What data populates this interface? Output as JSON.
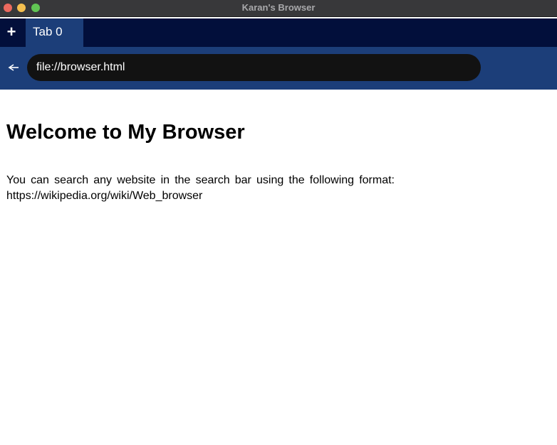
{
  "window": {
    "title": "Karan's Browser"
  },
  "tabstrip": {
    "new_tab_label": "+",
    "tabs": [
      {
        "label": "Tab 0"
      }
    ]
  },
  "toolbar": {
    "back_icon": "back-arrow-icon",
    "url_value": "file://browser.html"
  },
  "page": {
    "heading": "Welcome to My Browser",
    "paragraph_line1": "You can search any website in the search bar using the following format:",
    "paragraph_line2": "https://wikipedia.org/wiki/Web_browser"
  },
  "colors": {
    "titlebar": "#38383a",
    "tabstrip": "#020f3b",
    "active_tab": "#1c3e79",
    "addressbar": "#1c3e79",
    "url_field": "#121212"
  }
}
